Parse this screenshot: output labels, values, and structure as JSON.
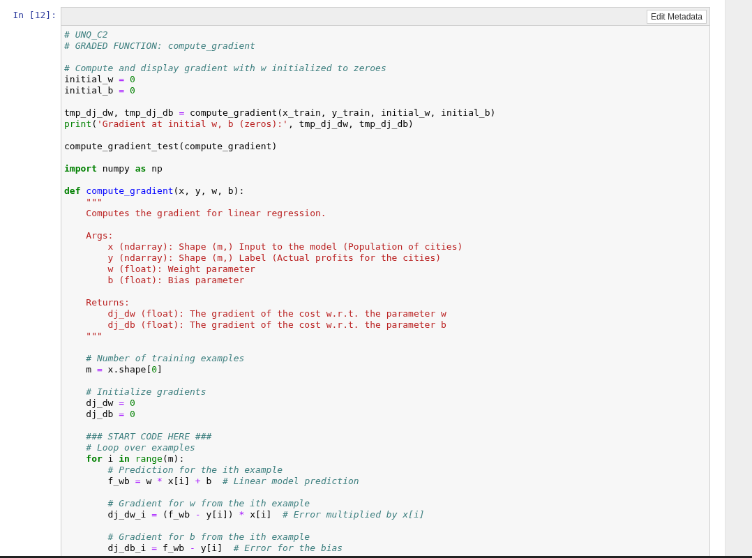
{
  "cell": {
    "prompt": "In [12]:",
    "toolbar_button": "Edit Metadata",
    "lines": [
      {
        "gap_before": false,
        "tokens": [
          {
            "kind": "comment",
            "text": "# UNQ_C2"
          }
        ]
      },
      {
        "gap_before": false,
        "tokens": [
          {
            "kind": "comment",
            "text": "# GRADED FUNCTION: compute_gradient"
          }
        ]
      },
      {
        "gap_before": true,
        "tokens": [
          {
            "kind": "comment",
            "text": "# Compute and display gradient with w initialized to zeroes"
          }
        ]
      },
      {
        "gap_before": false,
        "tokens": [
          {
            "kind": "plain",
            "text": "initial_w "
          },
          {
            "kind": "op",
            "text": "="
          },
          {
            "kind": "num",
            "text": " 0"
          }
        ]
      },
      {
        "gap_before": false,
        "tokens": [
          {
            "kind": "plain",
            "text": "initial_b "
          },
          {
            "kind": "op",
            "text": "="
          },
          {
            "kind": "num",
            "text": " 0"
          }
        ]
      },
      {
        "gap_before": true,
        "tokens": [
          {
            "kind": "plain",
            "text": "tmp_dj_dw, tmp_dj_db "
          },
          {
            "kind": "op",
            "text": "="
          },
          {
            "kind": "plain",
            "text": " compute_gradient(x_train, y_train, initial_w, initial_b)"
          }
        ]
      },
      {
        "gap_before": false,
        "tokens": [
          {
            "kind": "builtin",
            "text": "print"
          },
          {
            "kind": "plain",
            "text": "("
          },
          {
            "kind": "string",
            "text": "'Gradient at initial w, b (zeros):'"
          },
          {
            "kind": "plain",
            "text": ", tmp_dj_dw, tmp_dj_db)"
          }
        ]
      },
      {
        "gap_before": true,
        "tokens": [
          {
            "kind": "plain",
            "text": "compute_gradient_test(compute_gradient)"
          }
        ]
      },
      {
        "gap_before": true,
        "tokens": [
          {
            "kind": "keyword",
            "text": "import"
          },
          {
            "kind": "plain",
            "text": " numpy "
          },
          {
            "kind": "keyword",
            "text": "as"
          },
          {
            "kind": "plain",
            "text": " np"
          }
        ]
      },
      {
        "gap_before": true,
        "tokens": [
          {
            "kind": "keyword",
            "text": "def "
          },
          {
            "kind": "defname",
            "text": "compute_gradient"
          },
          {
            "kind": "plain",
            "text": "(x, y, w, b):"
          }
        ]
      },
      {
        "gap_before": false,
        "tokens": [
          {
            "kind": "string",
            "text": "    \"\"\""
          }
        ]
      },
      {
        "gap_before": false,
        "tokens": [
          {
            "kind": "string",
            "text": "    Computes the gradient for linear regression."
          }
        ]
      },
      {
        "gap_before": true,
        "tokens": [
          {
            "kind": "string",
            "text": "    Args:"
          }
        ]
      },
      {
        "gap_before": false,
        "tokens": [
          {
            "kind": "string",
            "text": "        x (ndarray): Shape (m,) Input to the model (Population of cities)"
          }
        ]
      },
      {
        "gap_before": false,
        "tokens": [
          {
            "kind": "string",
            "text": "        y (ndarray): Shape (m,) Label (Actual profits for the cities)"
          }
        ]
      },
      {
        "gap_before": false,
        "tokens": [
          {
            "kind": "string",
            "text": "        w (float): Weight parameter"
          }
        ]
      },
      {
        "gap_before": false,
        "tokens": [
          {
            "kind": "string",
            "text": "        b (float): Bias parameter"
          }
        ]
      },
      {
        "gap_before": true,
        "tokens": [
          {
            "kind": "string",
            "text": "    Returns:"
          }
        ]
      },
      {
        "gap_before": false,
        "tokens": [
          {
            "kind": "string",
            "text": "        dj_dw (float): The gradient of the cost w.r.t. the parameter w"
          }
        ]
      },
      {
        "gap_before": false,
        "tokens": [
          {
            "kind": "string",
            "text": "        dj_db (float): The gradient of the cost w.r.t. the parameter b"
          }
        ]
      },
      {
        "gap_before": false,
        "tokens": [
          {
            "kind": "string",
            "text": "    \"\"\""
          }
        ]
      },
      {
        "gap_before": true,
        "tokens": [
          {
            "kind": "comment",
            "text": "    # Number of training examples"
          }
        ]
      },
      {
        "gap_before": false,
        "tokens": [
          {
            "kind": "plain",
            "text": "    m "
          },
          {
            "kind": "op",
            "text": "="
          },
          {
            "kind": "plain",
            "text": " x.shape["
          },
          {
            "kind": "num",
            "text": "0"
          },
          {
            "kind": "plain",
            "text": "]"
          }
        ]
      },
      {
        "gap_before": true,
        "tokens": [
          {
            "kind": "comment",
            "text": "    # Initialize gradients"
          }
        ]
      },
      {
        "gap_before": false,
        "tokens": [
          {
            "kind": "plain",
            "text": "    dj_dw "
          },
          {
            "kind": "op",
            "text": "="
          },
          {
            "kind": "num",
            "text": " 0"
          }
        ]
      },
      {
        "gap_before": false,
        "tokens": [
          {
            "kind": "plain",
            "text": "    dj_db "
          },
          {
            "kind": "op",
            "text": "="
          },
          {
            "kind": "num",
            "text": " 0"
          }
        ]
      },
      {
        "gap_before": true,
        "tokens": [
          {
            "kind": "comment",
            "text": "    ### START CODE HERE ###"
          }
        ]
      },
      {
        "gap_before": false,
        "tokens": [
          {
            "kind": "comment",
            "text": "    # Loop over examples"
          }
        ]
      },
      {
        "gap_before": false,
        "tokens": [
          {
            "kind": "keyword",
            "text": "    for"
          },
          {
            "kind": "plain",
            "text": " i "
          },
          {
            "kind": "keyword",
            "text": "in"
          },
          {
            "kind": "builtin",
            "text": " range"
          },
          {
            "kind": "plain",
            "text": "(m):"
          }
        ]
      },
      {
        "gap_before": false,
        "tokens": [
          {
            "kind": "comment",
            "text": "        # Prediction for the ith example"
          }
        ]
      },
      {
        "gap_before": false,
        "tokens": [
          {
            "kind": "plain",
            "text": "        f_wb "
          },
          {
            "kind": "op",
            "text": "="
          },
          {
            "kind": "plain",
            "text": " w "
          },
          {
            "kind": "op",
            "text": "*"
          },
          {
            "kind": "plain",
            "text": " x[i] "
          },
          {
            "kind": "op",
            "text": "+"
          },
          {
            "kind": "plain",
            "text": " b  "
          },
          {
            "kind": "comment",
            "text": "# Linear model prediction"
          }
        ]
      },
      {
        "gap_before": true,
        "tokens": [
          {
            "kind": "comment",
            "text": "        # Gradient for w from the ith example"
          }
        ]
      },
      {
        "gap_before": false,
        "tokens": [
          {
            "kind": "plain",
            "text": "        dj_dw_i "
          },
          {
            "kind": "op",
            "text": "="
          },
          {
            "kind": "plain",
            "text": " (f_wb "
          },
          {
            "kind": "op",
            "text": "-"
          },
          {
            "kind": "plain",
            "text": " y[i]) "
          },
          {
            "kind": "op",
            "text": "*"
          },
          {
            "kind": "plain",
            "text": " x[i]  "
          },
          {
            "kind": "comment",
            "text": "# Error multiplied by x[i]"
          }
        ]
      },
      {
        "gap_before": true,
        "tokens": [
          {
            "kind": "comment",
            "text": "        # Gradient for b from the ith example"
          }
        ]
      },
      {
        "gap_before": false,
        "tokens": [
          {
            "kind": "plain",
            "text": "        dj_db_i "
          },
          {
            "kind": "op",
            "text": "="
          },
          {
            "kind": "plain",
            "text": " f_wb "
          },
          {
            "kind": "op",
            "text": "-"
          },
          {
            "kind": "plain",
            "text": " y[i]  "
          },
          {
            "kind": "comment",
            "text": "# Error for the bias"
          }
        ]
      }
    ]
  }
}
